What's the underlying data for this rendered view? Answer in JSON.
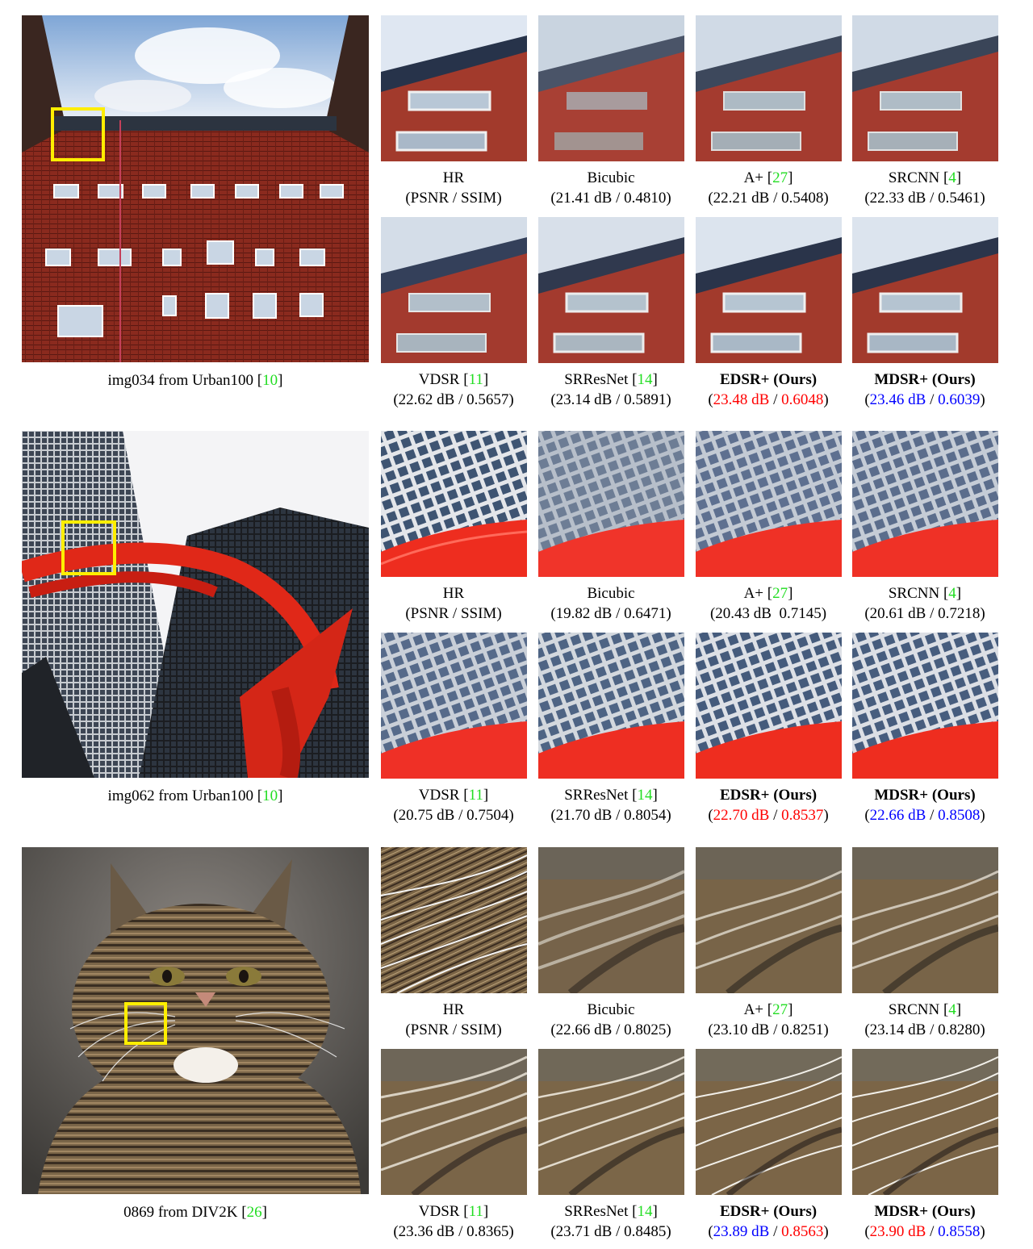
{
  "colors": {
    "reference": "#22dd22",
    "best": "#ff0000",
    "second": "#0000ff",
    "zoom_box": "#ffee00"
  },
  "groups": [
    {
      "image_name": "img034 from Urban100",
      "image_ref": "10",
      "scene": "brick-building",
      "row1": [
        {
          "method": "HR",
          "ref": "",
          "stats": "(PSNR / SSIM)"
        },
        {
          "method": "Bicubic",
          "ref": "",
          "stats": "(21.41 dB / 0.4810)"
        },
        {
          "method": "A+",
          "ref": "27",
          "stats": "(22.21 dB / 0.5408)"
        },
        {
          "method": "SRCNN",
          "ref": "4",
          "stats": "(22.33 dB / 0.5461)"
        }
      ],
      "row2": [
        {
          "method": "VDSR",
          "ref": "11",
          "stats": "(22.62 dB / 0.5657)"
        },
        {
          "method": "SRResNet",
          "ref": "14",
          "stats": "(23.14 dB / 0.5891)"
        },
        {
          "method": "EDSR+ (Ours)",
          "psnr": "23.48 dB",
          "ssim": "0.6048"
        },
        {
          "method": "MDSR+ (Ours)",
          "psnr": "23.46 dB",
          "ssim": "0.6039"
        }
      ]
    },
    {
      "image_name": "img062 from Urban100",
      "image_ref": "10",
      "scene": "skyscrapers-red-sculpture",
      "row1": [
        {
          "method": "HR",
          "ref": "",
          "stats": "(PSNR / SSIM)"
        },
        {
          "method": "Bicubic",
          "ref": "",
          "stats": "(19.82 dB / 0.6471)"
        },
        {
          "method": "A+",
          "ref": "27",
          "stats": "(20.43 dB  0.7145)"
        },
        {
          "method": "SRCNN",
          "ref": "4",
          "stats": "(20.61 dB / 0.7218)"
        }
      ],
      "row2": [
        {
          "method": "VDSR",
          "ref": "11",
          "stats": "(20.75 dB / 0.7504)"
        },
        {
          "method": "SRResNet",
          "ref": "14",
          "stats": "(21.70 dB / 0.8054)"
        },
        {
          "method": "EDSR+ (Ours)",
          "psnr": "22.70 dB",
          "ssim": "0.8537"
        },
        {
          "method": "MDSR+ (Ours)",
          "psnr": "22.66 dB",
          "ssim": "0.8508"
        }
      ]
    },
    {
      "image_name": "0869 from DIV2K",
      "image_ref": "26",
      "scene": "tabby-cat",
      "row1": [
        {
          "method": "HR",
          "ref": "",
          "stats": "(PSNR / SSIM)"
        },
        {
          "method": "Bicubic",
          "ref": "",
          "stats": "(22.66 dB / 0.8025)"
        },
        {
          "method": "A+",
          "ref": "27",
          "stats": "(23.10 dB / 0.8251)"
        },
        {
          "method": "SRCNN",
          "ref": "4",
          "stats": "(23.14 dB / 0.8280)"
        }
      ],
      "row2": [
        {
          "method": "VDSR",
          "ref": "11",
          "stats": "(23.36 dB / 0.8365)"
        },
        {
          "method": "SRResNet",
          "ref": "14",
          "stats": "(23.71 dB / 0.8485)"
        },
        {
          "method": "EDSR+ (Ours)",
          "psnr": "23.89 dB",
          "ssim": "0.8563"
        },
        {
          "method": "MDSR+ (Ours)",
          "psnr": "23.90 dB",
          "ssim": "0.8558"
        }
      ]
    }
  ]
}
